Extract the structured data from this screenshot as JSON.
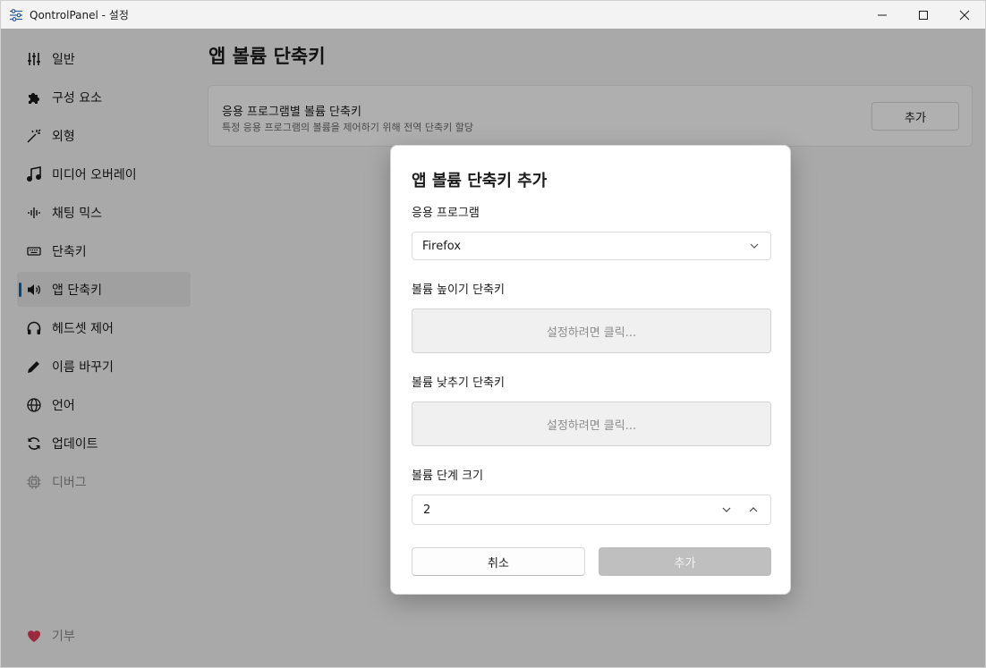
{
  "window": {
    "title": "QontrolPanel - 설정"
  },
  "sidebar": {
    "items": [
      {
        "label": "일반",
        "icon": "sliders-icon"
      },
      {
        "label": "구성 요소",
        "icon": "puzzle-icon"
      },
      {
        "label": "외형",
        "icon": "magic-wand-icon"
      },
      {
        "label": "미디어 오버레이",
        "icon": "music-note-icon"
      },
      {
        "label": "채팅 믹스",
        "icon": "waveform-icon"
      },
      {
        "label": "단축키",
        "icon": "keyboard-icon"
      },
      {
        "label": "앱 단축키",
        "icon": "speaker-icon"
      },
      {
        "label": "헤드셋 제어",
        "icon": "headphones-icon"
      },
      {
        "label": "이름 바꾸기",
        "icon": "pencil-icon"
      },
      {
        "label": "언어",
        "icon": "globe-icon"
      },
      {
        "label": "업데이트",
        "icon": "refresh-icon"
      },
      {
        "label": "디버그",
        "icon": "chip-icon"
      }
    ],
    "selected_index": 6,
    "donate": {
      "label": "기부",
      "icon": "heart-icon",
      "color": "#e03c5a"
    }
  },
  "main": {
    "title": "앱 볼륨 단축키",
    "card": {
      "title": "응용 프로그램별 볼륨 단축키",
      "description": "특정 응용 프로그램의 볼륨을 제어하기 위해 전역 단축키 할당",
      "button": "추가"
    }
  },
  "dialog": {
    "title": "앱 볼륨 단축키 추가",
    "app_label": "응용 프로그램",
    "app_value": "Firefox",
    "volume_up_label": "볼륨 높이기 단축키",
    "volume_up_placeholder": "설정하려면 클릭...",
    "volume_down_label": "볼륨 낮추기 단축키",
    "volume_down_placeholder": "설정하려면 클릭...",
    "step_label": "볼륨 단계 크기",
    "step_value": "2",
    "cancel": "취소",
    "add": "추가"
  },
  "colors": {
    "accent": "#0067c0"
  }
}
